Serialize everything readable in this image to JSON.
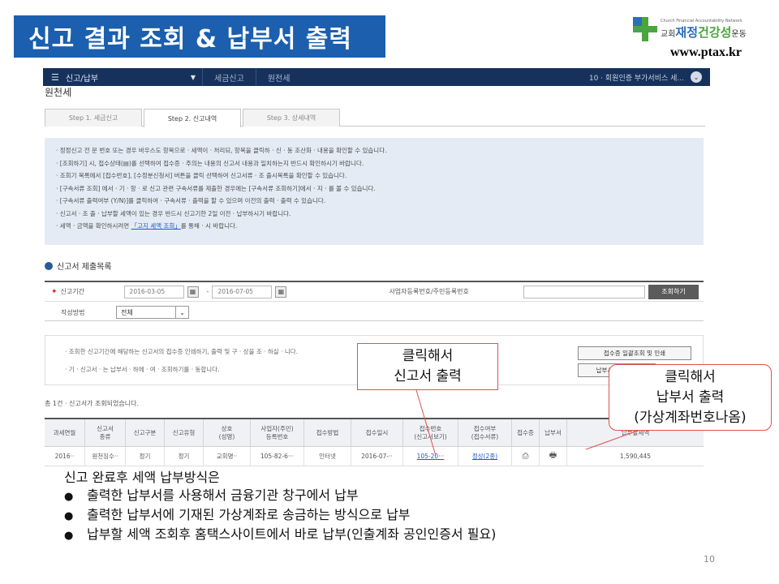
{
  "slide": {
    "title": "신고 결과 조회 & 납부서 출력",
    "logo_small": "Church Financial Accountability Network",
    "logo_pre": "교회",
    "logo_blue": "재정",
    "logo_green": "건강성",
    "logo_post": "운동",
    "url": "www.ptax.kr",
    "page_number": "10"
  },
  "app": {
    "nav": {
      "menu_label": "신고/납부",
      "breadcrumb": [
        "세금신고",
        "원천세"
      ],
      "user": "10 · 회원인증 부가서비스 세..."
    },
    "page_heading": "원천세",
    "tabs": [
      {
        "label": "Step 1. 세금신고",
        "active": false
      },
      {
        "label": "Step 2. 신고내역",
        "active": true
      },
      {
        "label": "Step 3. 상세내역",
        "active": false
      }
    ],
    "info_lines": [
      "· 정정신고 전 문 번호 또는 경우 바우스도 항목으로 · 세액이 · 처리되, 항목을 클릭하 · 신 · 동 조산화 · 내용을 확인할 수 있습니다.",
      "· [조회하기] 시, 접수상태(▤)를 선택하여 접수증 · 주의는 내용의 신고서 내용과 일치하는지 반드시 확인하시기 바랍니다.",
      "· 조회기 목록에서 [접수번호], [수정분신청서] 버튼을 클릭 선택하여 신고서류 · 조 출시목록을 확인할 수 있습니다.",
      "· [구속서류 조회] 에서 · 기 · 항 · 로 신고 관련 구속서류를 제출한 경우에는 [구속서류 조회하기]에서 · 지 · 를 볼 수 있습니다.",
      "· [구속서류 출력여부 (Y/N)]를 클릭하여 · 구속서류 · 출력을 할 수 있으며 이전의 출력 · 출력 수 있습니다.",
      "· 신고서 · 조 출 · 납부할 세액이 있는 경우 반드시 신고기한 2일 이전 · 납부하시기 바랍니다.",
      "· 세액 · 금액을 확인하시려면"
    ],
    "info_link": "「고지 세액 조회」",
    "info_tail": "를 통해 · 시 바랍니다.",
    "section_title": "신고서 제출목록",
    "search": {
      "period_label": "신고기간",
      "date_from": "2016-03-05",
      "date_to": "2016-07-05",
      "biz_label": "사업자등록번호/주민등록번호",
      "button": "조회하기",
      "method_label": "작성방법",
      "method_value": "전체"
    },
    "notice": [
      "· 조회한 신고기간에 해당하는 신고서의 접수증 인쇄하기, 출력 및 구 · 상을 조 · 하실 · 니다.",
      "· 기 · 신고서 · 는 납부서 · 하에 · 여 · 조회하기를 · 동합니다."
    ],
    "notice_buttons": [
      "접수증 일괄조회 및 인쇄",
      "납부서 일괄출력"
    ],
    "count_text": "총 1건 · 신고서가 조회되었습니다.",
    "grid": {
      "headers": [
        "과세연월",
        "신고서\n종류",
        "신고구분",
        "신고유형",
        "상호\n(성명)",
        "사업자(주민)\n등록번호",
        "접수방법",
        "접수일시",
        "접수번호\n(신고서보기)",
        "접수여부\n(접수서류)",
        "접수증",
        "납부서",
        "납부할세액"
      ],
      "row": [
        "2016··",
        "원천징수··",
        "정기",
        "정기",
        "교회명··",
        "105-82-6···",
        "인터넷",
        "2016-07-··",
        "105-20···",
        "정상(2종)",
        "",
        "",
        "1,590,445"
      ]
    }
  },
  "callouts": {
    "c1": [
      "클릭해서",
      "신고서 출력"
    ],
    "c2": [
      "클릭해서",
      "납부서 출력",
      "(가상계좌번호나옴)"
    ]
  },
  "bottom": {
    "intro": "신고 완료후 세액 납부방식은",
    "items": [
      "출력한 납부서를 사용해서 금융기관 창구에서 납부",
      "출력한 납부서에 기재된 가상계좌로 송금하는 방식으로 납부",
      "납부할 세액 조회후 홈택스사이트에서 바로 납부(인출계좌 공인인증서 필요)"
    ]
  }
}
